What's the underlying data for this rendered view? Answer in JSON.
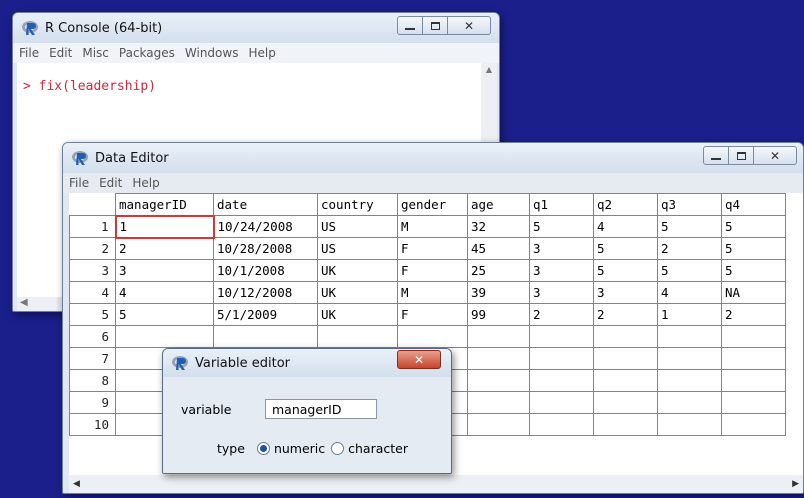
{
  "console": {
    "title": "R Console (64-bit)",
    "menu": [
      "File",
      "Edit",
      "Misc",
      "Packages",
      "Windows",
      "Help"
    ],
    "prompt": ">",
    "command": "fix(leadership)"
  },
  "editor": {
    "title": "Data Editor",
    "menu": [
      "File",
      "Edit",
      "Help"
    ],
    "columns": [
      "managerID",
      "date",
      "country",
      "gender",
      "age",
      "q1",
      "q2",
      "q3",
      "q4"
    ],
    "row_numbers": [
      "1",
      "2",
      "3",
      "4",
      "5",
      "6",
      "7",
      "8",
      "9",
      "10"
    ],
    "rows": [
      [
        "1",
        "10/24/2008",
        "US",
        "M",
        "32",
        "5",
        "4",
        "5",
        "5"
      ],
      [
        "2",
        "10/28/2008",
        "US",
        "F",
        "45",
        "3",
        "5",
        "2",
        "5"
      ],
      [
        "3",
        "10/1/2008",
        "UK",
        "F",
        "25",
        "3",
        "5",
        "5",
        "5"
      ],
      [
        "4",
        "10/12/2008",
        "UK",
        "M",
        "39",
        "3",
        "3",
        "4",
        "NA"
      ],
      [
        "5",
        "5/1/2009",
        "UK",
        "F",
        "99",
        "2",
        "2",
        "1",
        "2"
      ]
    ]
  },
  "var_editor": {
    "title": "Variable editor",
    "variable_label": "variable",
    "variable_value": "managerID",
    "type_label": "type",
    "option_numeric": "numeric",
    "option_character": "character",
    "selected": "numeric"
  },
  "colors": {
    "desktop": "#1a1f8c",
    "grid_line": "#e25a5a",
    "console_text": "#d3263a"
  }
}
